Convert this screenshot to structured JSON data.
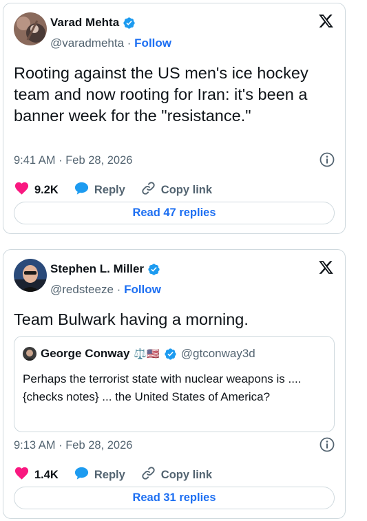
{
  "tweets": [
    {
      "author_name": "Varad Mehta",
      "handle": "@varadmehta",
      "separator": "·",
      "follow_label": "Follow",
      "text": "Rooting against the US men's ice hockey team and now rooting for Iran: it's been a banner week for the \"resistance.\"",
      "timestamp": "9:41 AM · Feb 28, 2026",
      "likes": "9.2K",
      "reply_label": "Reply",
      "copy_label": "Copy link",
      "read_replies": "Read 47 replies"
    },
    {
      "author_name": "Stephen L. Miller",
      "handle": "@redsteeze",
      "separator": "·",
      "follow_label": "Follow",
      "text": "Team Bulwark having a morning.",
      "quote": {
        "author_name": "George Conway",
        "emoji": "⚖️🇺🇸",
        "handle": "@gtconway3d",
        "text": "Perhaps the terrorist state with nuclear weapons is .... {checks notes} ... the United States of America?"
      },
      "timestamp": "9:13 AM · Feb 28, 2026",
      "likes": "1.4K",
      "reply_label": "Reply",
      "copy_label": "Copy link",
      "read_replies": "Read 31 replies"
    }
  ],
  "colors": {
    "accent": "#1d6ff2",
    "like": "#f91880",
    "verified": "#1d9bf0",
    "muted": "#536471",
    "border": "#cfd9de"
  },
  "icons": [
    "verified-badge-icon",
    "x-logo-icon",
    "info-icon",
    "heart-icon",
    "reply-bubble-icon",
    "link-icon"
  ]
}
